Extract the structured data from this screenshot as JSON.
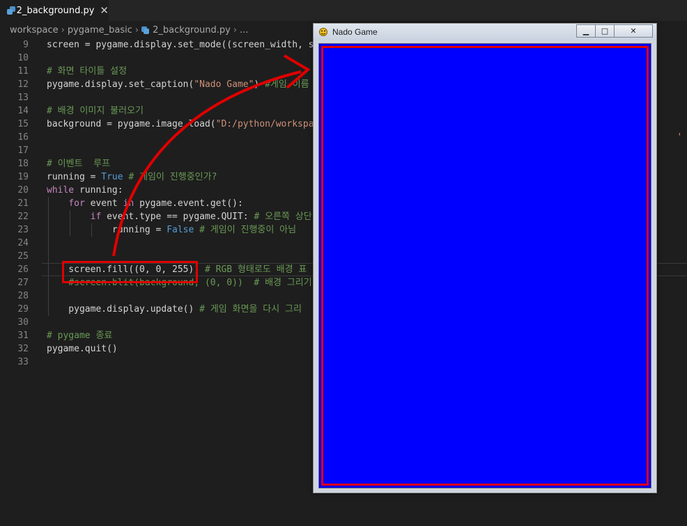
{
  "tab": {
    "filename": "2_background.py",
    "close_glyph": "✕"
  },
  "breadcrumb": {
    "items": [
      "workspace",
      "pygame_basic",
      "2_background.py",
      "..."
    ],
    "separator": "›"
  },
  "editor": {
    "lines": [
      {
        "n": "9",
        "tokens": [
          [
            "screen = pygame.display.set_mode((screen_width, sc",
            ""
          ]
        ]
      },
      {
        "n": "10",
        "tokens": []
      },
      {
        "n": "11",
        "tokens": [
          [
            "# 화면 타이틀 설정",
            "cm"
          ]
        ]
      },
      {
        "n": "12",
        "tokens": [
          [
            "pygame.display.set_caption(",
            ""
          ],
          [
            "\"Nado Game\"",
            "str"
          ],
          [
            ") ",
            ""
          ],
          [
            "#게임 이름",
            "cm"
          ]
        ]
      },
      {
        "n": "13",
        "tokens": []
      },
      {
        "n": "14",
        "tokens": [
          [
            "# 배경 이미지 불러오기",
            "cm"
          ]
        ]
      },
      {
        "n": "15",
        "tokens": [
          [
            "background = pygame.image.load(",
            ""
          ],
          [
            "\"D:/python/workspac",
            "str"
          ]
        ]
      },
      {
        "n": "16",
        "tokens": []
      },
      {
        "n": "17",
        "tokens": []
      },
      {
        "n": "18",
        "tokens": [
          [
            "# 이벤트  루프",
            "cm"
          ]
        ]
      },
      {
        "n": "19",
        "tokens": [
          [
            "running = ",
            ""
          ],
          [
            "True",
            "bl"
          ],
          [
            " ",
            ""
          ],
          [
            "# 게임이 진행중인가?",
            "cm"
          ]
        ]
      },
      {
        "n": "20",
        "tokens": [
          [
            "while",
            "kw"
          ],
          [
            " running:",
            ""
          ]
        ]
      },
      {
        "n": "21",
        "tokens": [
          [
            "    ",
            ""
          ],
          [
            "for",
            "kw"
          ],
          [
            " event ",
            ""
          ],
          [
            "in",
            "kw"
          ],
          [
            " pygame.event.get():",
            ""
          ]
        ]
      },
      {
        "n": "22",
        "tokens": [
          [
            "        ",
            ""
          ],
          [
            "if",
            "kw"
          ],
          [
            " event.type == pygame.QUIT: ",
            ""
          ],
          [
            "# 오른쪽 상단",
            "cm"
          ]
        ]
      },
      {
        "n": "23",
        "tokens": [
          [
            "            running = ",
            ""
          ],
          [
            "False",
            "bl"
          ],
          [
            " ",
            ""
          ],
          [
            "# 게임이 진행중이 아님",
            "cm"
          ]
        ]
      },
      {
        "n": "24",
        "tokens": []
      },
      {
        "n": "25",
        "tokens": []
      },
      {
        "n": "26",
        "tokens": [
          [
            "    screen.fill((0, 0, 255)) ",
            ""
          ],
          [
            "# RGB 형태로도 배경 표",
            "cm"
          ]
        ]
      },
      {
        "n": "27",
        "tokens": [
          [
            "    ",
            ""
          ],
          [
            "#screen.blit(background, (0, 0))  # 배경 그리기",
            "cm"
          ]
        ]
      },
      {
        "n": "28",
        "tokens": []
      },
      {
        "n": "29",
        "tokens": [
          [
            "    pygame.display.update() ",
            ""
          ],
          [
            "# 게임 화면을 다시 그리",
            "cm"
          ]
        ]
      },
      {
        "n": "30",
        "tokens": []
      },
      {
        "n": "31",
        "tokens": [
          [
            "# pygame 종료",
            "cm"
          ]
        ]
      },
      {
        "n": "32",
        "tokens": [
          [
            "pygame.quit()",
            ""
          ]
        ]
      },
      {
        "n": "33",
        "tokens": []
      }
    ],
    "overflow_right_text": "' 또는"
  },
  "game_window": {
    "title": "Nado Game",
    "buttons": {
      "minimize": "▁",
      "maximize": "□",
      "close": "✕"
    },
    "fill_color": "#0000ff"
  },
  "colors": {
    "editor_bg": "#1e1e1e",
    "comment": "#6a9955",
    "string": "#ce9178",
    "keyword": "#c586c0",
    "builtin_const": "#569cd6",
    "highlight": "#e00000"
  }
}
